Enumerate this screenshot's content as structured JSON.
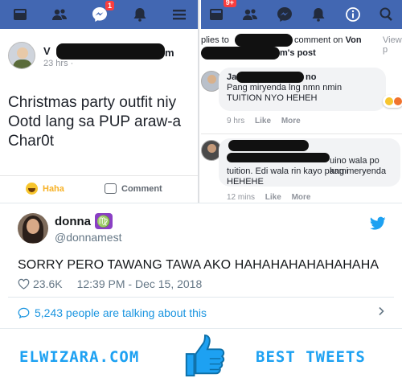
{
  "facebook_left": {
    "messenger_badge": "1",
    "poster_name_start": "V",
    "poster_name_end": "m",
    "post_time": "23 hrs ·",
    "post_text": "Christmas party outfit niy\nOotd lang sa PUP araw-a\nChar0t",
    "haha_label": "Haha",
    "comment_label": "Comment"
  },
  "facebook_right": {
    "notif_badge": "9+",
    "reply_header": {
      "prefix": "plies to",
      "comment_on": "comment on",
      "von": "Von",
      "view": "View p",
      "post_suffix": "m's post"
    },
    "comments": [
      {
        "name_start": "Ja",
        "name_end": "no",
        "text": "Pang miryenda lng nmn nmin\nTUITION NYO HEHEH",
        "time": "9 hrs",
        "like": "Like",
        "more": "More"
      },
      {
        "text_line1": "uino wala po kami",
        "text_rest": "tuition. Edi wala rin kayo pang meryenda\nHEHEHE",
        "time": "12 mins",
        "like": "Like",
        "more": "More"
      }
    ]
  },
  "tweet": {
    "name": "donna",
    "zodiac": "♍",
    "handle": "@donnamest",
    "text": "SORRY PERO TAWANG TAWA AKO HAHAHAHAHAHAHAHA",
    "likes": "23.6K",
    "timestamp": "12:39 PM - Dec 15, 2018",
    "talking": "5,243 people are talking about this"
  },
  "footer": {
    "left_brand": "ELWIZARA.COM",
    "right_brand": "BEST TWEETS"
  },
  "colors": {
    "facebook_blue": "#4267b2",
    "twitter_blue": "#1da1f2",
    "badge_red": "#fa3e3e"
  }
}
